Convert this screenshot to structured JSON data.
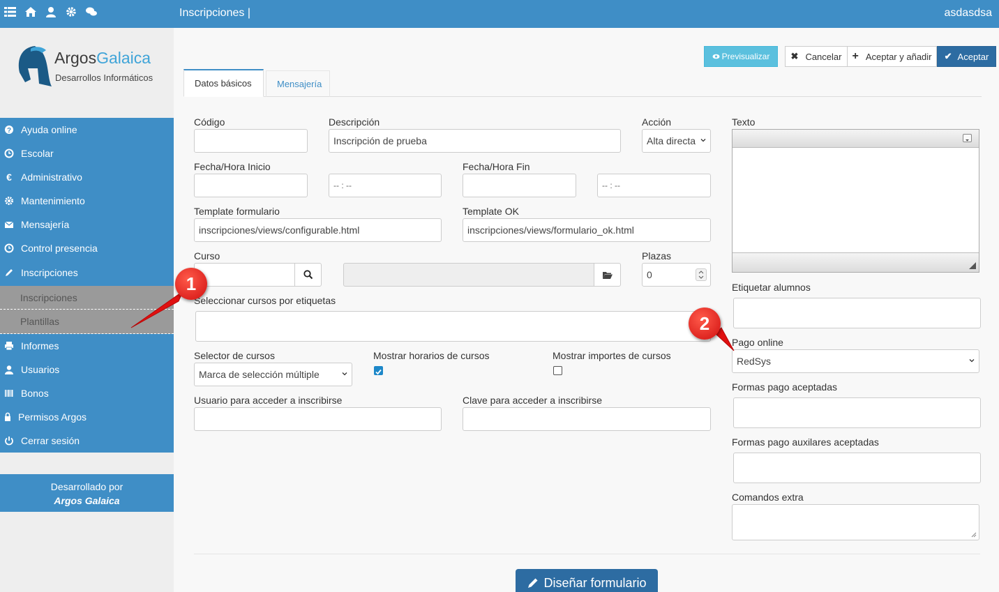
{
  "topbar": {
    "title": "Inscripciones |",
    "user": "asdasdsa",
    "icons": [
      "list-icon",
      "home-icon",
      "user-icon",
      "gear-icon",
      "chat-icon"
    ],
    "color": "#3f8ec6"
  },
  "logo": {
    "brand_a": "Argos",
    "brand_b": "Galaica",
    "tagline": "Desarrollos Informáticos"
  },
  "sidebar": {
    "items": [
      {
        "label": "Ayuda online",
        "icon": "question-circle-icon"
      },
      {
        "label": "Escolar",
        "icon": "clock-icon"
      },
      {
        "label": "Administrativo",
        "icon": "euro-icon"
      },
      {
        "label": "Mantenimiento",
        "icon": "gear-icon"
      },
      {
        "label": "Mensajería",
        "icon": "envelope-icon"
      },
      {
        "label": "Control presencia",
        "icon": "clock-icon"
      },
      {
        "label": "Inscripciones",
        "icon": "pencil-icon"
      }
    ],
    "subitems": [
      {
        "label": "Inscripciones"
      },
      {
        "label": "Plantillas"
      }
    ],
    "items_after": [
      {
        "label": "Informes",
        "icon": "print-icon"
      },
      {
        "label": "Usuarios",
        "icon": "user-icon"
      },
      {
        "label": "Bonos",
        "icon": "barcode-icon"
      },
      {
        "label": "Permisos Argos",
        "icon": "lock-icon"
      },
      {
        "label": "Cerrar sesión",
        "icon": "power-icon"
      }
    ],
    "footer_line1": "Desarrollado por",
    "footer_line2": "Argos Galaica"
  },
  "toolbar": {
    "preview": "Previsualizar",
    "cancel": "Cancelar",
    "accept_add": "Aceptar y añadir",
    "accept": "Aceptar"
  },
  "tabs": [
    {
      "label": "Datos básicos",
      "active": true
    },
    {
      "label": "Mensajería",
      "active": false
    }
  ],
  "form": {
    "codigo_label": "Código",
    "codigo_value": "",
    "descripcion_label": "Descripción",
    "descripcion_value": "Inscripción de prueba",
    "accion_label": "Acción",
    "accion_value": "Alta directa",
    "fecha_inicio_label": "Fecha/Hora Inicio",
    "fecha_fin_label": "Fecha/Hora Fin",
    "time_placeholder": "-- : --",
    "template_form_label": "Template formulario",
    "template_form_value": "inscripciones/views/configurable.html",
    "template_ok_label": "Template OK",
    "template_ok_value": "inscripciones/views/formulario_ok.html",
    "curso_label": "Curso",
    "plazas_label": "Plazas",
    "plazas_value": "0",
    "etiquetas_label": "Seleccionar cursos por etiquetas",
    "selector_label": "Selector de cursos",
    "selector_value": "Marca de selección múltiple",
    "mostrar_horarios_label": "Mostrar horarios de cursos",
    "mostrar_horarios_checked": true,
    "mostrar_importes_label": "Mostrar importes de cursos",
    "mostrar_importes_checked": false,
    "usuario_label": "Usuario para acceder a inscribirse",
    "clave_label": "Clave para acceder a inscribirse",
    "texto_label": "Texto",
    "etiquetar_label": "Etiquetar alumnos",
    "pago_label": "Pago online",
    "pago_value": "RedSys",
    "formas_label": "Formas pago aceptadas",
    "formas_aux_label": "Formas pago auxilares aceptadas",
    "comandos_label": "Comandos extra"
  },
  "design_button": "Diseñar formulario",
  "annotations": [
    {
      "number": "1"
    },
    {
      "number": "2"
    }
  ]
}
